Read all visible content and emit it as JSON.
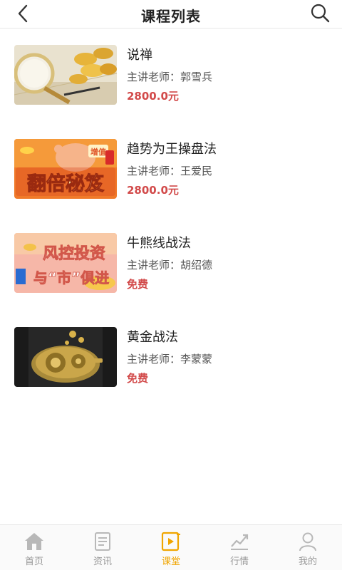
{
  "header": {
    "title": "课程列表",
    "back_icon": "chevron-left-icon",
    "search_icon": "search-icon"
  },
  "colors": {
    "price": "#d24a4a",
    "tab_active": "#f0a500",
    "tab_inactive": "#999999"
  },
  "courses": [
    {
      "name": "说禅",
      "teacher": "主讲老师：郭雪兵",
      "price": "2800.0元"
    },
    {
      "name": "趋势为王操盘法",
      "teacher": "主讲老师：王爱民",
      "price": "2800.0元"
    },
    {
      "name": "牛熊线战法",
      "teacher": "主讲老师：胡绍德",
      "price": "免费"
    },
    {
      "name": "黄金战法",
      "teacher": "主讲老师：李蒙蒙",
      "price": "免费"
    }
  ],
  "thumbnails": {
    "t2": {
      "line1": "增值",
      "line2": "翻倍秘笈"
    },
    "t3": {
      "line1": "风控投资",
      "line2": "与“市”俱进"
    }
  },
  "tabbar": {
    "active": 2,
    "items": [
      {
        "label": "首页",
        "icon": "home-icon"
      },
      {
        "label": "资讯",
        "icon": "news-icon"
      },
      {
        "label": "课堂",
        "icon": "classroom-icon"
      },
      {
        "label": "行情",
        "icon": "market-chart-icon"
      },
      {
        "label": "我的",
        "icon": "profile-icon"
      }
    ]
  }
}
